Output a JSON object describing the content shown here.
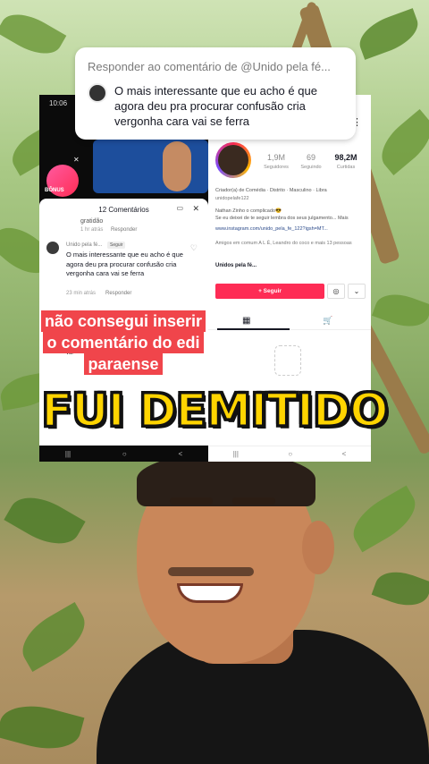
{
  "reply_card": {
    "header": "Responder ao comentário de @Unido pela fé...",
    "text": "O mais interessante que eu acho é que agora deu pra procurar confusão cria vergonha cara vai se ferra"
  },
  "left_phone": {
    "time": "10:06",
    "bonus_label": "BÔNUS",
    "comments_title": "12 Comentários",
    "prev_comment": "gratidão",
    "prev_meta": "1 hr atrás",
    "reply_label": "Responder",
    "comment": {
      "user": "Unido pela fé...",
      "follow": "Seguir",
      "body": "O mais interessante que eu acho é que agora deu pra procurar confusão cria vergonha cara vai se ferra",
      "meta": "23 min atrás",
      "reply": "Responder"
    },
    "tail_text": "vai"
  },
  "right_phone": {
    "stats": [
      {
        "num": "1,9M",
        "label": "Seguidores"
      },
      {
        "num": "69",
        "label": "Seguindo"
      },
      {
        "num": "98,2M",
        "label": "Curtidas"
      }
    ],
    "bio_line1": "Criador(a) de Comédia · Distrito · Masculino · Libra",
    "bio_line2": "unidopelafe122",
    "bio_line3": "Nathan Zinho o complicado😎",
    "bio_line4": "Se eu deixei de te seguir lembra dos seus julgamento... Mais",
    "link": "www.instagram.com/unido_pela_fe_122?igsh=MT...",
    "friends": "Amigos em comum A L Ê, Leandro do coco e mais 13 pessoas",
    "group": "Unidos pela fé...",
    "follow_button": "+ Seguir"
  },
  "captions": {
    "red_lines": [
      "não consegui inserir",
      "o comentário do edi",
      "paraense"
    ],
    "title": "FUI DEMITIDO"
  },
  "nav_icons": [
    "|||",
    "○",
    "<"
  ]
}
